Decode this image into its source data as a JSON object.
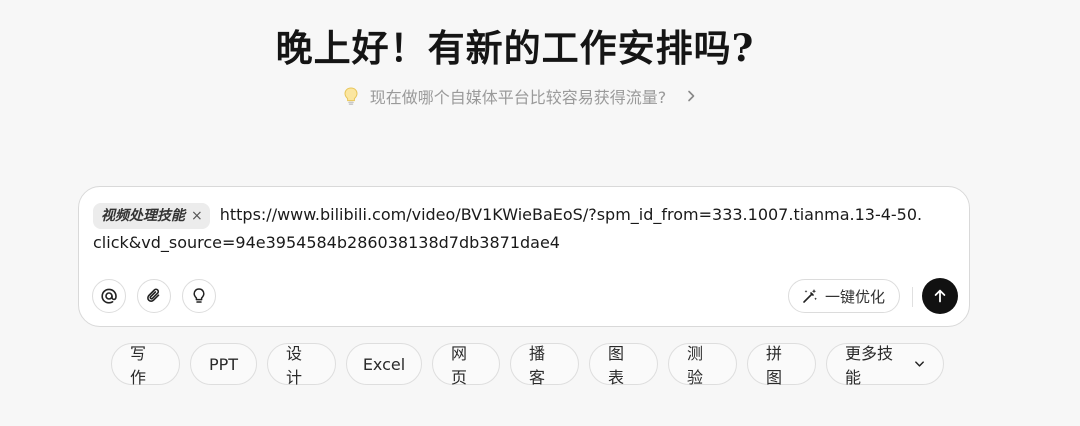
{
  "headline": "晚上好！有新的工作安排吗?",
  "suggestion": {
    "text": "现在做哪个自媒体平台比较容易获得流量?",
    "icon": "lightbulb-icon"
  },
  "composer": {
    "skill_chip": "视频处理技能",
    "chip_close": "×",
    "input_text": "https://www.bilibili.com/video/BV1KWieBaEoS/?spm_id_from=333.1007.tianma.13-4-50.click&vd_source=94e3954584b286038138d7db3871dae4",
    "optimize_label": "一键优化"
  },
  "skills": [
    "写作",
    "PPT",
    "设计",
    "Excel",
    "网页",
    "播客",
    "图表",
    "测验",
    "拼图",
    "更多技能"
  ],
  "colors": {
    "background": "#f7f7f7",
    "send_button": "#111111",
    "muted_text": "#9a9a9a"
  }
}
